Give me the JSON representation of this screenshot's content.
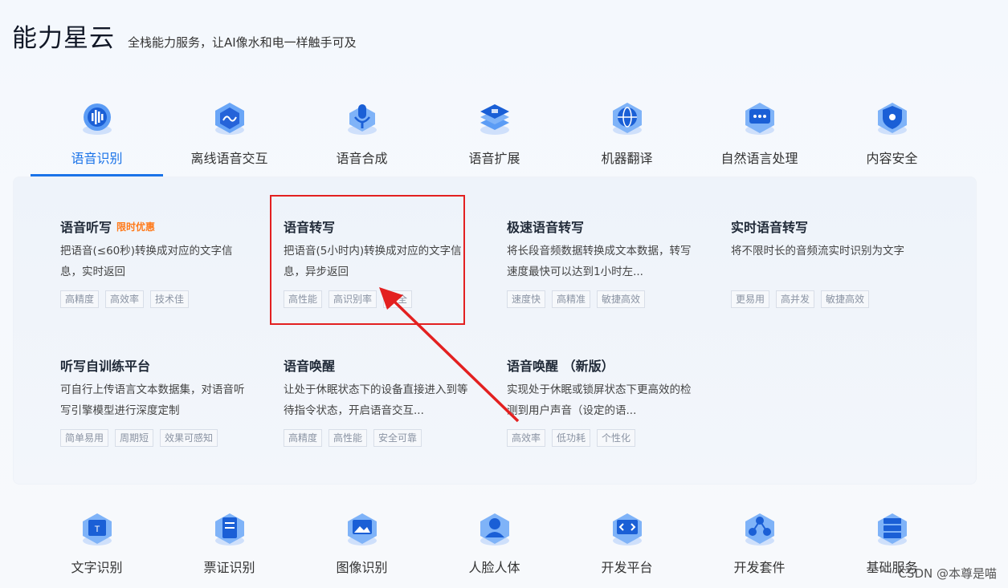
{
  "header": {
    "title": "能力星云",
    "subtitle": "全栈能力服务，让AI像水和电一样触手可及"
  },
  "tabs": [
    {
      "label": "语音识别",
      "icon": "speech-recognition-icon",
      "active": true
    },
    {
      "label": "离线语音交互",
      "icon": "offline-voice-icon"
    },
    {
      "label": "语音合成",
      "icon": "microphone-icon"
    },
    {
      "label": "语音扩展",
      "icon": "layers-icon"
    },
    {
      "label": "机器翻译",
      "icon": "globe-icon"
    },
    {
      "label": "自然语言处理",
      "icon": "chat-icon"
    },
    {
      "label": "内容安全",
      "icon": "shield-icon"
    }
  ],
  "cards": [
    {
      "title": "语音听写",
      "promo": "限时优惠",
      "desc": "把语音(≤60秒)转换成对应的文字信息，实时返回",
      "tags": [
        "高精度",
        "高效率",
        "技术佳"
      ]
    },
    {
      "title": "语音转写",
      "promo": "",
      "desc": "把语音(5小时内)转换成对应的文字信息，异步返回",
      "tags": [
        "高性能",
        "高识别率",
        "安全"
      ]
    },
    {
      "title": "极速语音转写",
      "promo": "",
      "desc": "将长段音频数据转换成文本数据，转写速度最快可以达到1小时左...",
      "tags": [
        "速度快",
        "高精准",
        "敏捷高效"
      ]
    },
    {
      "title": "实时语音转写",
      "promo": "",
      "desc": "将不限时长的音频流实时识别为文字",
      "tags": [
        "更易用",
        "高并发",
        "敏捷高效"
      ]
    },
    {
      "title": "听写自训练平台",
      "promo": "",
      "desc": "可自行上传语言文本数据集，对语音听写引擎模型进行深度定制",
      "tags": [
        "简单易用",
        "周期短",
        "效果可感知"
      ]
    },
    {
      "title": "语音唤醒",
      "promo": "",
      "desc": "让处于休眠状态下的设备直接进入到等待指令状态，开启语音交互...",
      "tags": [
        "高精度",
        "高性能",
        "安全可靠"
      ]
    },
    {
      "title": "语音唤醒 （新版）",
      "promo": "",
      "desc": "实现处于休眠或锁屏状态下更高效的检测到用户声音（设定的语...",
      "tags": [
        "高效率",
        "低功耗",
        "个性化"
      ]
    }
  ],
  "bottom": [
    {
      "label": "文字识别",
      "icon": "text-recognition-icon"
    },
    {
      "label": "票证识别",
      "icon": "ticket-icon"
    },
    {
      "label": "图像识别",
      "icon": "image-icon"
    },
    {
      "label": "人脸人体",
      "icon": "face-icon"
    },
    {
      "label": "开发平台",
      "icon": "code-icon"
    },
    {
      "label": "开发套件",
      "icon": "kit-icon"
    },
    {
      "label": "基础服务",
      "icon": "server-icon"
    }
  ],
  "watermark": "CSDN @本尊是喵",
  "colors": {
    "accent": "#1a73e8",
    "promo": "#ff7a1a",
    "annotation": "#e32020"
  }
}
